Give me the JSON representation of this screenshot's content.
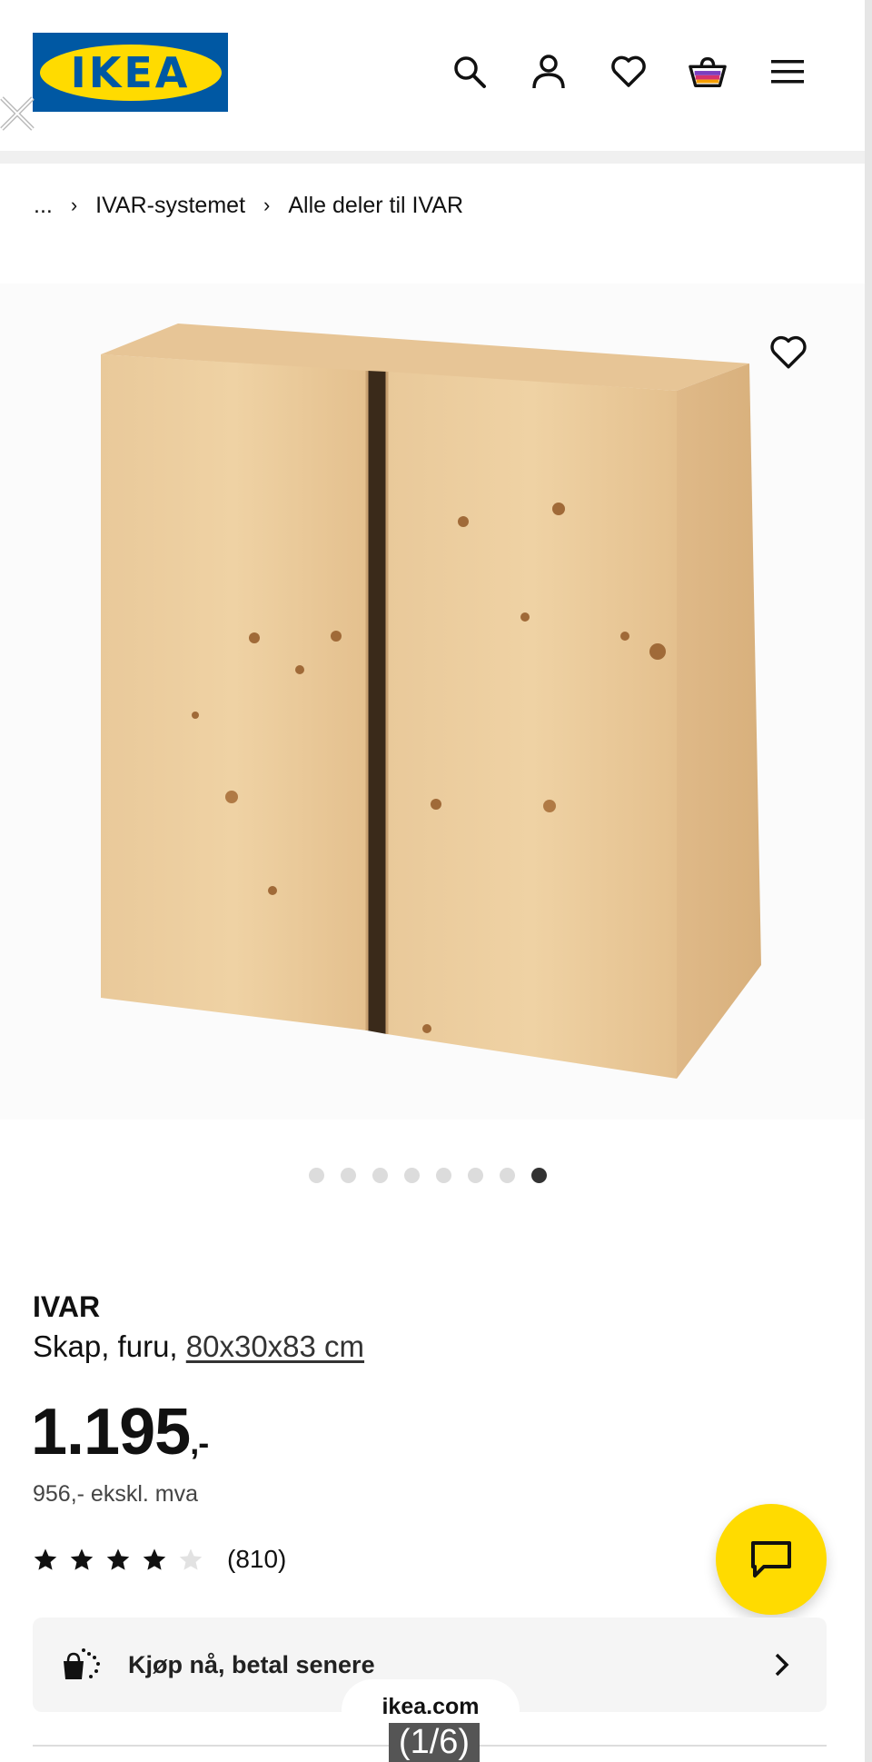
{
  "header": {
    "logo_text": "IKEA",
    "logo_reg": "®",
    "icons": [
      "search-icon",
      "account-icon",
      "wishlist-icon",
      "cart-icon",
      "menu-icon"
    ]
  },
  "breadcrumb": {
    "ellipsis": "...",
    "items": [
      "IVAR-systemet",
      "Alle deler til IVAR"
    ],
    "separator": "›"
  },
  "carousel": {
    "total": 8,
    "active_index": 7
  },
  "product": {
    "name": "IVAR",
    "description": "Skap, furu, ",
    "dimensions": "80x30x83 cm",
    "price_main": "1.195",
    "price_dec": ",-",
    "price_ex_vat": "956,- ekskl. mva",
    "rating_stars": 4,
    "rating_count": "(810)"
  },
  "pay_later": {
    "label": "Kjøp nå, betal senere"
  },
  "browser": {
    "url": "ikea.com",
    "page_indicator": "(1/6)"
  },
  "colors": {
    "ikea_blue": "#0058a3",
    "ikea_yellow": "#ffdb00"
  }
}
